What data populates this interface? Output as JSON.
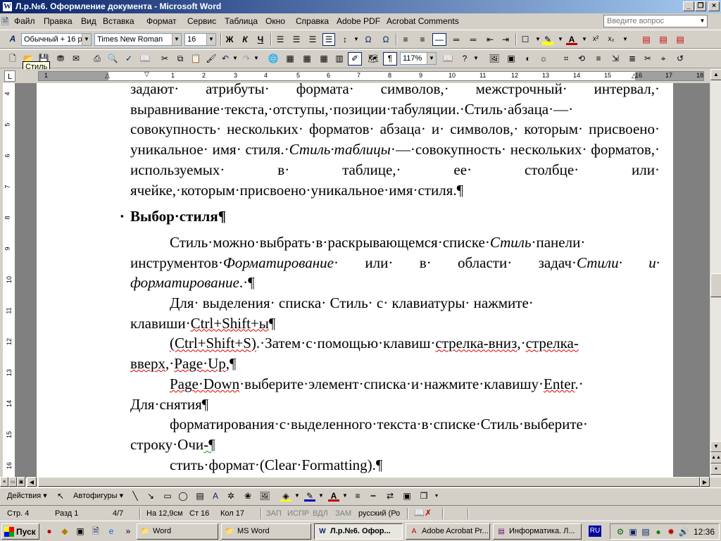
{
  "window": {
    "title": "Л.р.№6. Оформление документа - Microsoft Word",
    "app_icon": "W"
  },
  "menu": [
    "Файл",
    "Правка",
    "Вид",
    "Вставка",
    "Формат",
    "Сервис",
    "Таблица",
    "Окно",
    "Справка",
    "Adobe PDF",
    "Acrobat Comments"
  ],
  "help_box": {
    "placeholder": "Введите вопрос"
  },
  "formatting": {
    "style": "Обычный + 16 р",
    "font": "Times New Roman",
    "size": "16",
    "bold": "Ж",
    "italic": "К",
    "underline": "Ч"
  },
  "standard": {
    "zoom": "117%",
    "tooltip": "Стиль"
  },
  "ruler": {
    "numbers": [
      "1",
      "1",
      "2",
      "3",
      "4",
      "5",
      "6",
      "7",
      "8",
      "9",
      "10",
      "11",
      "12",
      "13",
      "14",
      "15",
      "16",
      "17",
      "18"
    ],
    "v_numbers": [
      "4",
      "5",
      "6",
      "7",
      "8",
      "9",
      "10",
      "11",
      "12",
      "13",
      "14",
      "15",
      "16"
    ]
  },
  "document": {
    "p1": "задают· атрибуты· формата· символов,· межстрочный· интервал,· выравнивание·текста,·отступы,·позиции·табуляции.·Стиль·абзаца·—· совокупность· нескольких· форматов· абзаца· и· символов,· которым· присвоено· уникальное· имя· стиля.·",
    "p1_italic": "Стиль·таблицы",
    "p1_rest": "·—·совокупность· нескольких· форматов,· используемых· в· таблице,· ее· столбце· или· ячейке,·которым·присвоено·уникальное·имя·стиля.¶",
    "heading": "Выбор·стиля¶",
    "heading_bullet": "▪",
    "p2_a": "Стиль·можно·выбрать·в·раскрывающемся·списке·",
    "p2_i1": "Стиль",
    "p2_b": "·панели· инструментов·",
    "p2_i2": "Форматирование",
    "p2_c": "· или· в· области· задач·",
    "p2_i3": "Стили· и· форматирование",
    "p2_d": ".·¶",
    "p3_a": "Для· выделения· списка· Стиль· с· клавиатуры· нажмите· клавиши·",
    "p3_b": "Ctrl+Shift+ы",
    "p3_c": "¶",
    "p4_a": "(Ctrl+Shift+S)",
    "p4_b": ".·Затем·с·помощью·клавиш·",
    "p4_c": "стрелка-вниз",
    "p4_d": ",·",
    "p4_e": "стрелка-вверх",
    "p4_f": ",·",
    "p4_g": "Page·Up",
    "p4_h": ",¶",
    "p5_a": "Page·Down",
    "p5_b": "·выберите·элемент·списка·и·нажмите·клавишу·",
    "p5_c": "Enter",
    "p5_d": ".· Для·снятия¶",
    "p6_a": "форматирования·с·выделенного·текста·в·списке·Стиль·выберите· строку·Очи",
    "p6_b": "-¶",
    "p7": "стить·формат·(Clear·Formatting).¶"
  },
  "drawing": {
    "actions": "Действия",
    "autoshapes": "Автофигуры"
  },
  "status": {
    "page": "Стр.  4",
    "section": "Разд  1",
    "pages": "4/7",
    "at": "На 12,9см",
    "line": "Ст 16",
    "col": "Кол  17",
    "rec": "ЗАП",
    "trk": "ИСПР",
    "ext": "ВДЛ",
    "ovr": "ЗАМ",
    "lang": "русский (Ро"
  },
  "taskbar": {
    "start": "Пуск",
    "tasks": [
      "Word",
      "MS Word",
      "Л.р.№6. Офор...",
      "Adobe Acrobat Pr...",
      "Информатика. Л..."
    ],
    "lang": "RU",
    "clock": "12:36"
  }
}
